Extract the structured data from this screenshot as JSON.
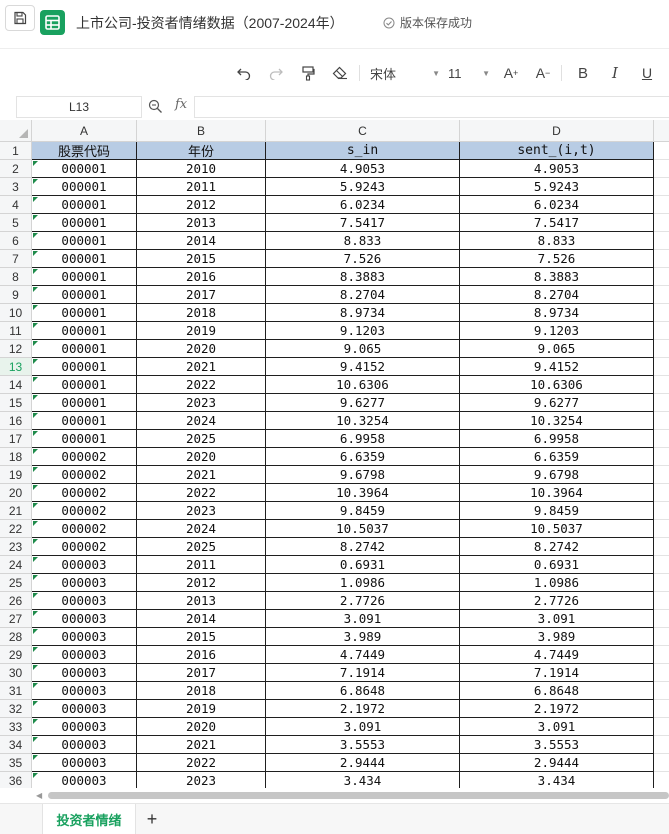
{
  "titlebar": {
    "doc_title": "上市公司-投资者情绪数据（2007-2024年）",
    "save_status": "版本保存成功"
  },
  "toolbar": {
    "font_name": "宋体",
    "font_size": "11",
    "bold_label": "B",
    "italic_label": "I",
    "underline_label": "U",
    "grow_label": "A",
    "shrink_label": "A"
  },
  "formulabar": {
    "cell_ref": "L13",
    "formula": ""
  },
  "grid": {
    "columns": [
      "A",
      "B",
      "C",
      "D"
    ],
    "active_row": 13,
    "header_row": [
      "股票代码",
      "年份",
      "s_in",
      "sent_(i,t)"
    ],
    "rows": [
      [
        "000001",
        "2010",
        "4.9053",
        "4.9053"
      ],
      [
        "000001",
        "2011",
        "5.9243",
        "5.9243"
      ],
      [
        "000001",
        "2012",
        "6.0234",
        "6.0234"
      ],
      [
        "000001",
        "2013",
        "7.5417",
        "7.5417"
      ],
      [
        "000001",
        "2014",
        "8.833",
        "8.833"
      ],
      [
        "000001",
        "2015",
        "7.526",
        "7.526"
      ],
      [
        "000001",
        "2016",
        "8.3883",
        "8.3883"
      ],
      [
        "000001",
        "2017",
        "8.2704",
        "8.2704"
      ],
      [
        "000001",
        "2018",
        "8.9734",
        "8.9734"
      ],
      [
        "000001",
        "2019",
        "9.1203",
        "9.1203"
      ],
      [
        "000001",
        "2020",
        "9.065",
        "9.065"
      ],
      [
        "000001",
        "2021",
        "9.4152",
        "9.4152"
      ],
      [
        "000001",
        "2022",
        "10.6306",
        "10.6306"
      ],
      [
        "000001",
        "2023",
        "9.6277",
        "9.6277"
      ],
      [
        "000001",
        "2024",
        "10.3254",
        "10.3254"
      ],
      [
        "000001",
        "2025",
        "6.9958",
        "6.9958"
      ],
      [
        "000002",
        "2020",
        "6.6359",
        "6.6359"
      ],
      [
        "000002",
        "2021",
        "9.6798",
        "9.6798"
      ],
      [
        "000002",
        "2022",
        "10.3964",
        "10.3964"
      ],
      [
        "000002",
        "2023",
        "9.8459",
        "9.8459"
      ],
      [
        "000002",
        "2024",
        "10.5037",
        "10.5037"
      ],
      [
        "000002",
        "2025",
        "8.2742",
        "8.2742"
      ],
      [
        "000003",
        "2011",
        "0.6931",
        "0.6931"
      ],
      [
        "000003",
        "2012",
        "1.0986",
        "1.0986"
      ],
      [
        "000003",
        "2013",
        "2.7726",
        "2.7726"
      ],
      [
        "000003",
        "2014",
        "3.091",
        "3.091"
      ],
      [
        "000003",
        "2015",
        "3.989",
        "3.989"
      ],
      [
        "000003",
        "2016",
        "4.7449",
        "4.7449"
      ],
      [
        "000003",
        "2017",
        "7.1914",
        "7.1914"
      ],
      [
        "000003",
        "2018",
        "6.8648",
        "6.8648"
      ],
      [
        "000003",
        "2019",
        "2.1972",
        "2.1972"
      ],
      [
        "000003",
        "2020",
        "3.091",
        "3.091"
      ],
      [
        "000003",
        "2021",
        "3.5553",
        "3.5553"
      ],
      [
        "000003",
        "2022",
        "2.9444",
        "2.9444"
      ],
      [
        "000003",
        "2023",
        "3.434",
        "3.434"
      ]
    ]
  },
  "sheets": {
    "active_sheet": "投资者情绪",
    "add_label": "+"
  },
  "colors": {
    "brand": "#19a15f",
    "header_fill": "#b8cce4"
  },
  "icons": [
    "save-icon",
    "app-logo-icon",
    "check-circle-icon",
    "undo-icon",
    "redo-icon",
    "format-painter-icon",
    "eraser-icon",
    "zoom-icon",
    "fx-icon"
  ]
}
